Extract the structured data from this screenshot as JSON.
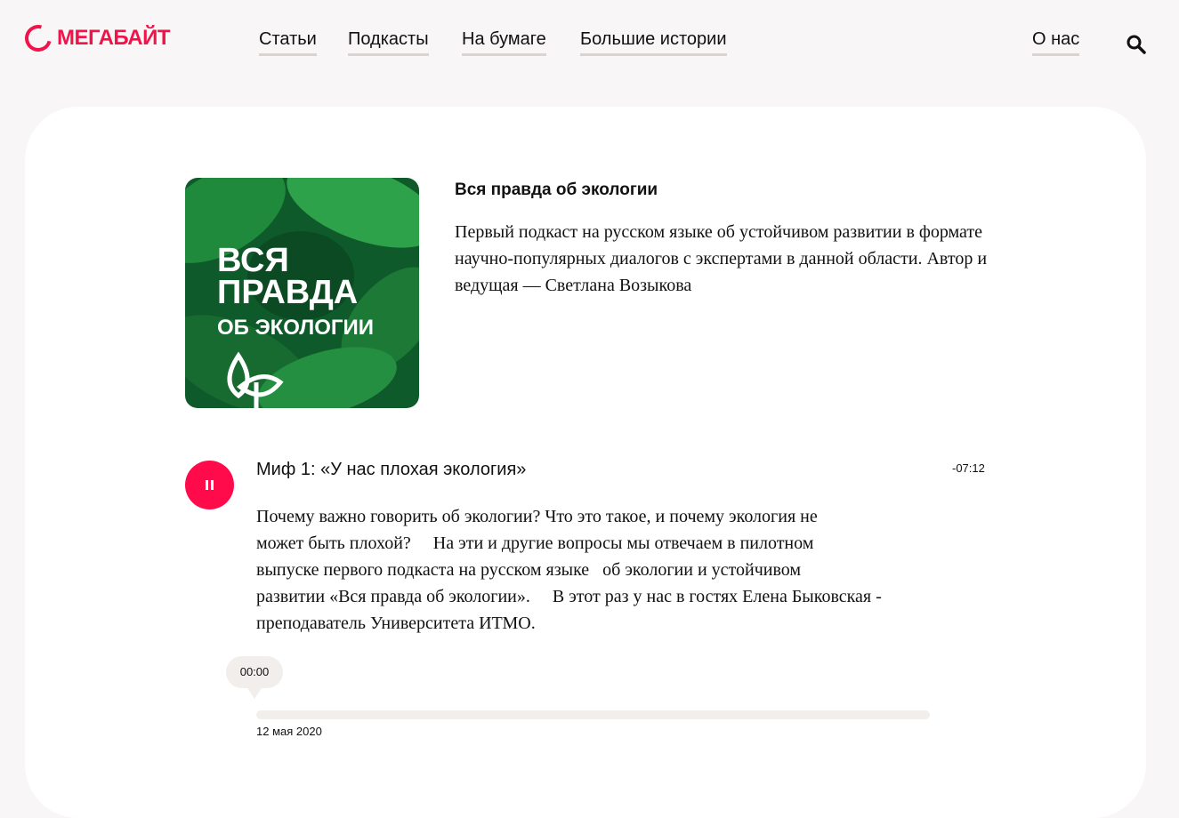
{
  "brand": {
    "logo_text": "МЕГАБАЙТ",
    "accent": "#f0144a"
  },
  "nav": {
    "items": [
      {
        "label": "Статьи"
      },
      {
        "label": "Подкасты"
      },
      {
        "label": "На бумаге"
      },
      {
        "label": "Большие истории"
      }
    ],
    "about": "О нас",
    "search_icon": "search-icon"
  },
  "podcast": {
    "cover_lines": [
      "ВСЯ",
      "ПРАВДА",
      "ОБ ЭКОЛОГИИ"
    ],
    "title": "Вся правда об экологии",
    "description": "Первый подкаст на русском языке об устойчивом развитии в формате научно-популярных диалогов с экспертами в данной области. Автор и ведущая — Светлана Возыкова"
  },
  "episode": {
    "title": "Миф 1: «У нас плохая экология»",
    "remaining": "-07:12",
    "description": "Почему важно говорить об экологии? Что это такое, и почему экология не\nможет быть плохой?     На эти и другие вопросы мы отвечаем в пилотном\nвыпуске первого подкаста на русском языке   об экологии и устойчивом\nразвитии «Вся правда об экологии».     В этот раз у нас в гостях Елена Быковская -\nпреподаватель Университета ИТМО.",
    "current_time": "00:00",
    "progress": 0,
    "date": "12 мая 2020",
    "play_state": "pause-icon"
  }
}
